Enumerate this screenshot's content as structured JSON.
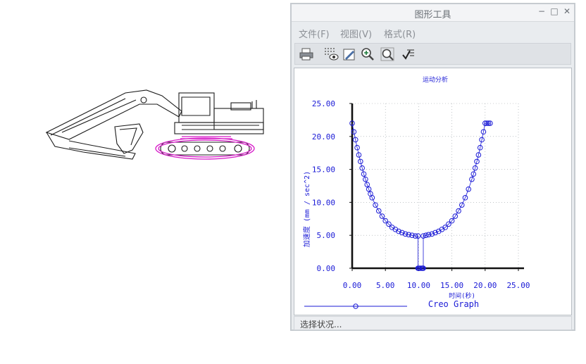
{
  "window": {
    "title": "图形工具",
    "controls": {
      "minimize": "−",
      "maximize": "□",
      "close": "✕"
    }
  },
  "menu": [
    {
      "label": "文件(F)"
    },
    {
      "label": "视图(V)"
    },
    {
      "label": "格式(R)"
    }
  ],
  "toolbar": [
    {
      "icon": "print-icon"
    },
    {
      "icon": "grid-visibility-icon"
    },
    {
      "icon": "edit-format-icon"
    },
    {
      "icon": "zoom-in-icon"
    },
    {
      "icon": "zoom-fit-icon"
    },
    {
      "icon": "check-list-icon"
    }
  ],
  "chart_data": {
    "type": "scatter",
    "title": "运动分析",
    "xlabel": "时间(秒)",
    "ylabel": "加速度 (mm / sec^2)",
    "watermark": "Creo Graph",
    "xlim": [
      0,
      25
    ],
    "ylim": [
      0,
      25
    ],
    "xticks": [
      "0.00",
      "5.00",
      "10.00",
      "15.00",
      "20.00",
      "25.00"
    ],
    "yticks": [
      "0.00",
      "5.00",
      "10.00",
      "15.00",
      "20.00",
      "25.00"
    ],
    "grid": true,
    "color": "#1a1ad6",
    "series": [
      {
        "x": [
          0.0,
          0.25,
          0.5,
          0.75,
          1.0,
          1.25,
          1.5,
          1.75,
          2.0,
          2.25,
          2.5,
          2.75,
          3.0,
          3.5,
          4.0,
          4.5,
          5.0,
          5.5,
          6.0,
          6.5,
          7.0,
          7.5,
          8.0,
          8.5,
          9.0,
          9.5,
          9.9,
          9.9,
          10.0,
          10.1,
          10.3,
          10.5,
          10.6,
          10.7,
          10.7,
          11.1,
          11.5,
          12.0,
          12.5,
          13.0,
          13.5,
          14.0,
          14.5,
          15.0,
          15.5,
          16.0,
          16.5,
          17.0,
          17.5,
          18.0,
          18.25,
          18.5,
          18.75,
          19.0,
          19.25,
          19.5,
          19.75,
          20.0,
          20.25,
          20.5,
          20.75
        ],
        "y": [
          22.0,
          20.7,
          19.5,
          18.3,
          17.2,
          16.2,
          15.2,
          14.3,
          13.5,
          12.7,
          12.0,
          11.3,
          10.7,
          9.6,
          8.7,
          7.9,
          7.2,
          6.7,
          6.2,
          5.9,
          5.6,
          5.4,
          5.2,
          5.1,
          5.0,
          4.9,
          4.9,
          0.0,
          0.0,
          0.0,
          0.0,
          0.0,
          0.0,
          0.0,
          4.9,
          5.0,
          5.1,
          5.2,
          5.4,
          5.6,
          5.9,
          6.2,
          6.7,
          7.2,
          7.9,
          8.7,
          9.6,
          10.7,
          12.0,
          13.5,
          14.3,
          15.2,
          16.2,
          17.2,
          18.3,
          19.5,
          20.7,
          22.0,
          22.0,
          22.0,
          22.0
        ]
      }
    ]
  },
  "status": {
    "text": "选择状况..."
  }
}
